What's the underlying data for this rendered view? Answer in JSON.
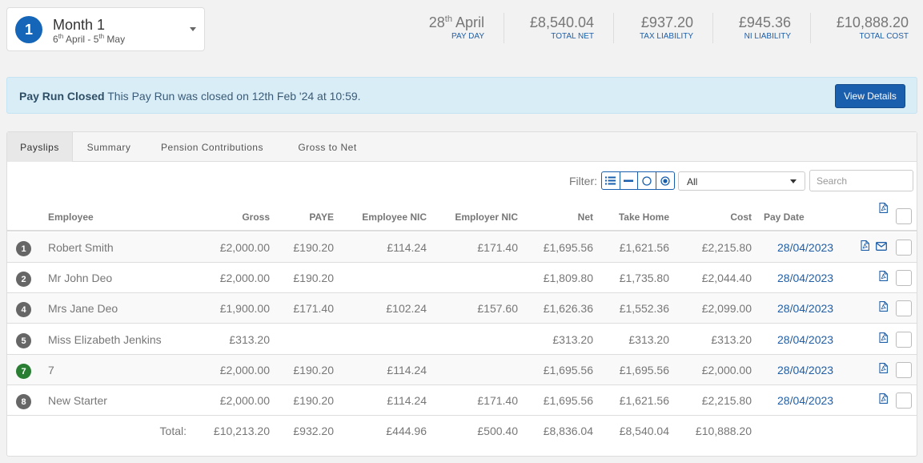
{
  "period": {
    "badge": "1",
    "title": "Month 1",
    "range_start_day": "6",
    "range_start_sup": "th",
    "range_start_rest": " April - ",
    "range_end_day": "5",
    "range_end_sup": "th",
    "range_end_rest": " May"
  },
  "stats": {
    "pay_day": {
      "day": "28",
      "sup": "th",
      "rest": " April",
      "label": "PAY DAY"
    },
    "total_net": {
      "value": "£8,540.04",
      "label": "TOTAL NET"
    },
    "tax_liability": {
      "value": "£937.20",
      "label": "TAX LIABILITY"
    },
    "ni_liability": {
      "value": "£945.36",
      "label": "NI LIABILITY"
    },
    "total_cost": {
      "value": "£10,888.20",
      "label": "TOTAL COST"
    }
  },
  "alert": {
    "strong": "Pay Run Closed",
    "text": " This Pay Run was closed on 12th Feb '24 at 10:59.",
    "button": "View Details"
  },
  "tabs": [
    "Payslips",
    "Summary",
    "Pension Contributions",
    "Gross to Net"
  ],
  "filter": {
    "label": "Filter:",
    "selected": "All",
    "search_placeholder": "Search"
  },
  "columns": {
    "employee": "Employee",
    "gross": "Gross",
    "paye": "PAYE",
    "employee_nic": "Employee NIC",
    "employer_nic": "Employer NIC",
    "net": "Net",
    "take_home": "Take Home",
    "cost": "Cost",
    "pay_date": "Pay Date"
  },
  "rows": [
    {
      "num": "1",
      "name": "Robert Smith",
      "gross": "£2,000.00",
      "paye": "£190.20",
      "employee_nic": "£114.24",
      "employer_nic": "£171.40",
      "net": "£1,695.56",
      "take_home": "£1,621.56",
      "cost": "£2,215.80",
      "pay_date": "28/04/2023"
    },
    {
      "num": "2",
      "name": "Mr John Deo",
      "gross": "£2,000.00",
      "paye": "£190.20",
      "employee_nic": "",
      "employer_nic": "",
      "net": "£1,809.80",
      "take_home": "£1,735.80",
      "cost": "£2,044.40",
      "pay_date": "28/04/2023"
    },
    {
      "num": "4",
      "name": "Mrs Jane Deo",
      "gross": "£1,900.00",
      "paye": "£171.40",
      "employee_nic": "£102.24",
      "employer_nic": "£157.60",
      "net": "£1,626.36",
      "take_home": "£1,552.36",
      "cost": "£2,099.00",
      "pay_date": "28/04/2023"
    },
    {
      "num": "5",
      "name": "Miss Elizabeth Jenkins",
      "gross": "£313.20",
      "paye": "",
      "employee_nic": "",
      "employer_nic": "",
      "net": "£313.20",
      "take_home": "£313.20",
      "cost": "£313.20",
      "pay_date": "28/04/2023"
    },
    {
      "num": "7",
      "name": "7",
      "gross": "£2,000.00",
      "paye": "£190.20",
      "employee_nic": "£114.24",
      "employer_nic": "",
      "net": "£1,695.56",
      "take_home": "£1,695.56",
      "cost": "£2,000.00",
      "pay_date": "28/04/2023"
    },
    {
      "num": "8",
      "name": "New Starter",
      "gross": "£2,000.00",
      "paye": "£190.20",
      "employee_nic": "£114.24",
      "employer_nic": "£171.40",
      "net": "£1,695.56",
      "take_home": "£1,621.56",
      "cost": "£2,215.80",
      "pay_date": "28/04/2023"
    }
  ],
  "totals": {
    "label": "Total:",
    "gross": "£10,213.20",
    "paye": "£932.20",
    "employee_nic": "£444.96",
    "employer_nic": "£500.40",
    "net": "£8,836.04",
    "take_home": "£8,540.04",
    "cost": "£10,888.20"
  },
  "colors": {
    "accent": "#1565b8",
    "link": "#1f5fa8",
    "alert_bg": "#d9edf7",
    "badge_green": "#2a7e34",
    "badge_grey": "#666666"
  },
  "icons": {
    "pdf": "pdf-file-icon",
    "mail": "envelope-icon",
    "caret": "caret-down-icon",
    "list": "list-icon",
    "minus": "minus-icon",
    "circle": "circle-outline-icon",
    "dot": "circle-dot-icon"
  }
}
